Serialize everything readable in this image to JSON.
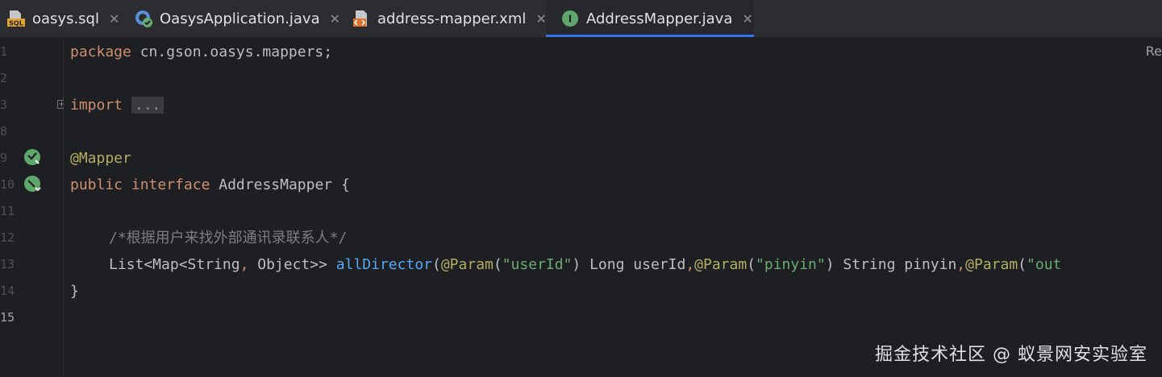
{
  "tabs": [
    {
      "label": "oasys.sql",
      "icon": "sql-file-icon",
      "active": false
    },
    {
      "label": "OasysApplication.java",
      "icon": "spring-boot-app-icon",
      "active": false
    },
    {
      "label": "address-mapper.xml",
      "icon": "xml-file-icon",
      "active": false
    },
    {
      "label": "AddressMapper.java",
      "icon": "interface-file-icon",
      "active": true
    }
  ],
  "tab_close_glyph": "✕",
  "editor": {
    "line_numbers": [
      "1",
      "2",
      "3",
      "8",
      "9",
      "10",
      "11",
      "12",
      "13",
      "14",
      "15"
    ],
    "reader_mode_label": "Re",
    "lines": {
      "l1_kw": "package",
      "l1_rest": " cn.gson.oasys.mappers;",
      "l3_kw": "import",
      "l3_fold": "...",
      "l9_ann": "@Mapper",
      "l10_kw1": "public",
      "l10_kw2": "interface",
      "l10_rest": " AddressMapper {",
      "l12_comment": "/*根据用户来找外部通讯录联系人*/",
      "l13_a": "List<Map<String",
      "l13_b": ",",
      "l13_c": " Object>> ",
      "l13_fn": "allDirector",
      "l13_d": "(",
      "l13_ann1": "@Param",
      "l13_e": "(",
      "l13_str1": "\"userId\"",
      "l13_f": ") Long userId",
      "l13_g": ",",
      "l13_ann2": "@Param",
      "l13_h": "(",
      "l13_str2": "\"pinyin\"",
      "l13_i": ") String pinyin",
      "l13_j": ",",
      "l13_ann3": "@Param",
      "l13_k": "(",
      "l13_str3": "\"out",
      "l14": "}"
    }
  },
  "watermark": "掘金技术社区 @ 蚁景网安实验室",
  "colors": {
    "keyword": "#cf8e6d",
    "annotation": "#b3ae60",
    "string": "#6aab73",
    "function": "#56a8f5",
    "comment": "#7a7e85",
    "text": "#bcbec4",
    "active_tab_underline": "#3574f0"
  }
}
